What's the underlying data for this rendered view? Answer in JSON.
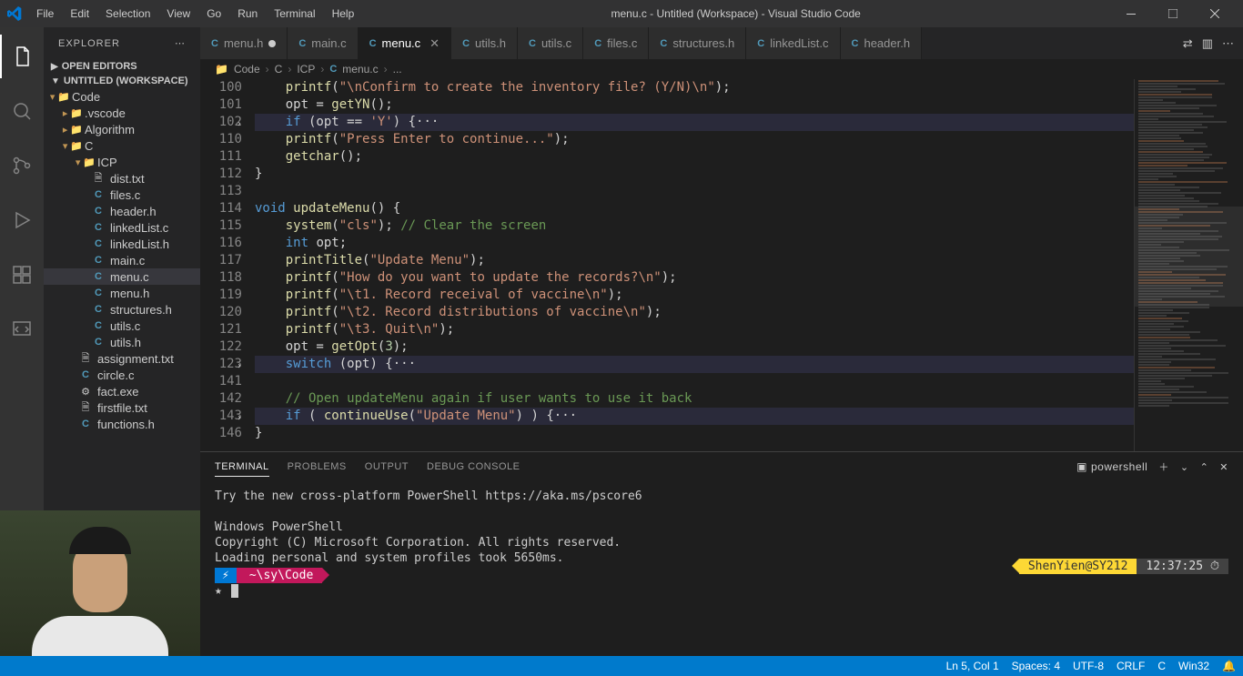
{
  "titlebar": {
    "menus": [
      "File",
      "Edit",
      "Selection",
      "View",
      "Go",
      "Run",
      "Terminal",
      "Help"
    ],
    "title": "menu.c - Untitled (Workspace) - Visual Studio Code"
  },
  "explorer": {
    "title": "EXPLORER",
    "sections": {
      "open_editors": "OPEN EDITORS",
      "workspace": "UNTITLED (WORKSPACE)"
    },
    "tree": [
      {
        "depth": 0,
        "kind": "folder",
        "icon": "folder",
        "label": "Code",
        "open": true
      },
      {
        "depth": 1,
        "kind": "folder",
        "icon": "folder",
        "label": ".vscode"
      },
      {
        "depth": 1,
        "kind": "folder",
        "icon": "folder",
        "label": "Algorithm"
      },
      {
        "depth": 1,
        "kind": "folder",
        "icon": "folder",
        "label": "C",
        "open": true
      },
      {
        "depth": 2,
        "kind": "folder",
        "icon": "folder",
        "label": "ICP",
        "open": true
      },
      {
        "depth": 3,
        "kind": "file",
        "icon": "txt-file",
        "label": "dist.txt"
      },
      {
        "depth": 3,
        "kind": "file",
        "icon": "c-file",
        "label": "files.c"
      },
      {
        "depth": 3,
        "kind": "file",
        "icon": "c-file",
        "label": "header.h"
      },
      {
        "depth": 3,
        "kind": "file",
        "icon": "c-file",
        "label": "linkedList.c"
      },
      {
        "depth": 3,
        "kind": "file",
        "icon": "c-file",
        "label": "linkedList.h"
      },
      {
        "depth": 3,
        "kind": "file",
        "icon": "c-file",
        "label": "main.c"
      },
      {
        "depth": 3,
        "kind": "file",
        "icon": "c-file",
        "label": "menu.c",
        "selected": true
      },
      {
        "depth": 3,
        "kind": "file",
        "icon": "c-file",
        "label": "menu.h"
      },
      {
        "depth": 3,
        "kind": "file",
        "icon": "c-file",
        "label": "structures.h"
      },
      {
        "depth": 3,
        "kind": "file",
        "icon": "c-file",
        "label": "utils.c"
      },
      {
        "depth": 3,
        "kind": "file",
        "icon": "c-file",
        "label": "utils.h"
      },
      {
        "depth": 2,
        "kind": "file",
        "icon": "txt-file",
        "label": "assignment.txt"
      },
      {
        "depth": 2,
        "kind": "file",
        "icon": "c-file",
        "label": "circle.c"
      },
      {
        "depth": 2,
        "kind": "file",
        "icon": "exe-file",
        "label": "fact.exe"
      },
      {
        "depth": 2,
        "kind": "file",
        "icon": "txt-file",
        "label": "firstfile.txt"
      },
      {
        "depth": 2,
        "kind": "file",
        "icon": "c-file",
        "label": "functions.h"
      }
    ]
  },
  "tabs": [
    {
      "label": "menu.h",
      "modified": true
    },
    {
      "label": "main.c"
    },
    {
      "label": "menu.c",
      "active": true,
      "closeable": true
    },
    {
      "label": "utils.h"
    },
    {
      "label": "utils.c"
    },
    {
      "label": "files.c"
    },
    {
      "label": "structures.h"
    },
    {
      "label": "linkedList.c"
    },
    {
      "label": "header.h"
    }
  ],
  "breadcrumb": [
    "Code",
    "C",
    "ICP",
    "menu.c",
    "..."
  ],
  "code": {
    "lines": [
      {
        "n": 100,
        "html": "    <span class='fn'>printf</span>(<span class='str'>\"\\nConfirm to create the inventory file? (Y/N)\\n\"</span>);"
      },
      {
        "n": 101,
        "html": "    opt = <span class='fn'>getYN</span>();"
      },
      {
        "n": 102,
        "html": "    <span class='kw'>if</span> (opt == <span class='str'>'Y'</span>) {<span class='op'>&#183;&#183;&#183;</span>",
        "fold": true,
        "hl": true
      },
      {
        "n": 110,
        "html": "    <span class='fn'>printf</span>(<span class='str'>\"Press Enter to continue...\"</span>);"
      },
      {
        "n": 111,
        "html": "    <span class='fn'>getchar</span>();"
      },
      {
        "n": 112,
        "html": "}"
      },
      {
        "n": 113,
        "html": ""
      },
      {
        "n": 114,
        "html": "<span class='typ'>void</span> <span class='fn'>updateMenu</span>() {"
      },
      {
        "n": 115,
        "html": "    <span class='fn'>system</span>(<span class='str'>\"cls\"</span>); <span class='cmt'>// Clear the screen</span>"
      },
      {
        "n": 116,
        "html": "    <span class='typ'>int</span> opt;"
      },
      {
        "n": 117,
        "html": "    <span class='fn'>printTitle</span>(<span class='str'>\"Update Menu\"</span>);"
      },
      {
        "n": 118,
        "html": "    <span class='fn'>printf</span>(<span class='str'>\"How do you want to update the records?\\n\"</span>);"
      },
      {
        "n": 119,
        "html": "    <span class='fn'>printf</span>(<span class='str'>\"\\t1. Record receival of vaccine\\n\"</span>);"
      },
      {
        "n": 120,
        "html": "    <span class='fn'>printf</span>(<span class='str'>\"\\t2. Record distributions of vaccine\\n\"</span>);"
      },
      {
        "n": 121,
        "html": "    <span class='fn'>printf</span>(<span class='str'>\"\\t3. Quit\\n\"</span>);"
      },
      {
        "n": 122,
        "html": "    opt = <span class='fn'>getOpt</span>(<span class='num'>3</span>);"
      },
      {
        "n": 123,
        "html": "    <span class='kw'>switch</span> (opt) {<span class='op'>&#183;&#183;&#183;</span>",
        "fold": true,
        "hl": true
      },
      {
        "n": 141,
        "html": ""
      },
      {
        "n": 142,
        "html": "    <span class='cmt'>// Open updateMenu again if user wants to use it back</span>"
      },
      {
        "n": 143,
        "html": "    <span class='kw'>if</span> ( <span class='fn'>continueUse</span>(<span class='str'>\"Update Menu\"</span>) ) {<span class='op'>&#183;&#183;&#183;</span>",
        "fold": true,
        "hl": true
      },
      {
        "n": 146,
        "html": "}"
      }
    ]
  },
  "panel": {
    "tabs": [
      "TERMINAL",
      "PROBLEMS",
      "OUTPUT",
      "DEBUG CONSOLE"
    ],
    "active_tab": 0,
    "shell_label": "powershell",
    "terminal": {
      "lines": [
        "Try the new cross-platform PowerShell https://aka.ms/pscore6",
        "",
        "Windows PowerShell",
        "Copyright (C) Microsoft Corporation. All rights reserved.",
        "Loading personal and system profiles took 5650ms."
      ],
      "prompt_path": "~\\sy\\Code",
      "prompt_user": "ShenYien@SY212",
      "prompt_time": "12:37:25 ⏱",
      "cursor_prefix": "★ "
    }
  },
  "statusbar": {
    "right": [
      "Ln 5, Col 1",
      "Spaces: 4",
      "UTF-8",
      "CRLF",
      "C",
      "Win32"
    ]
  }
}
